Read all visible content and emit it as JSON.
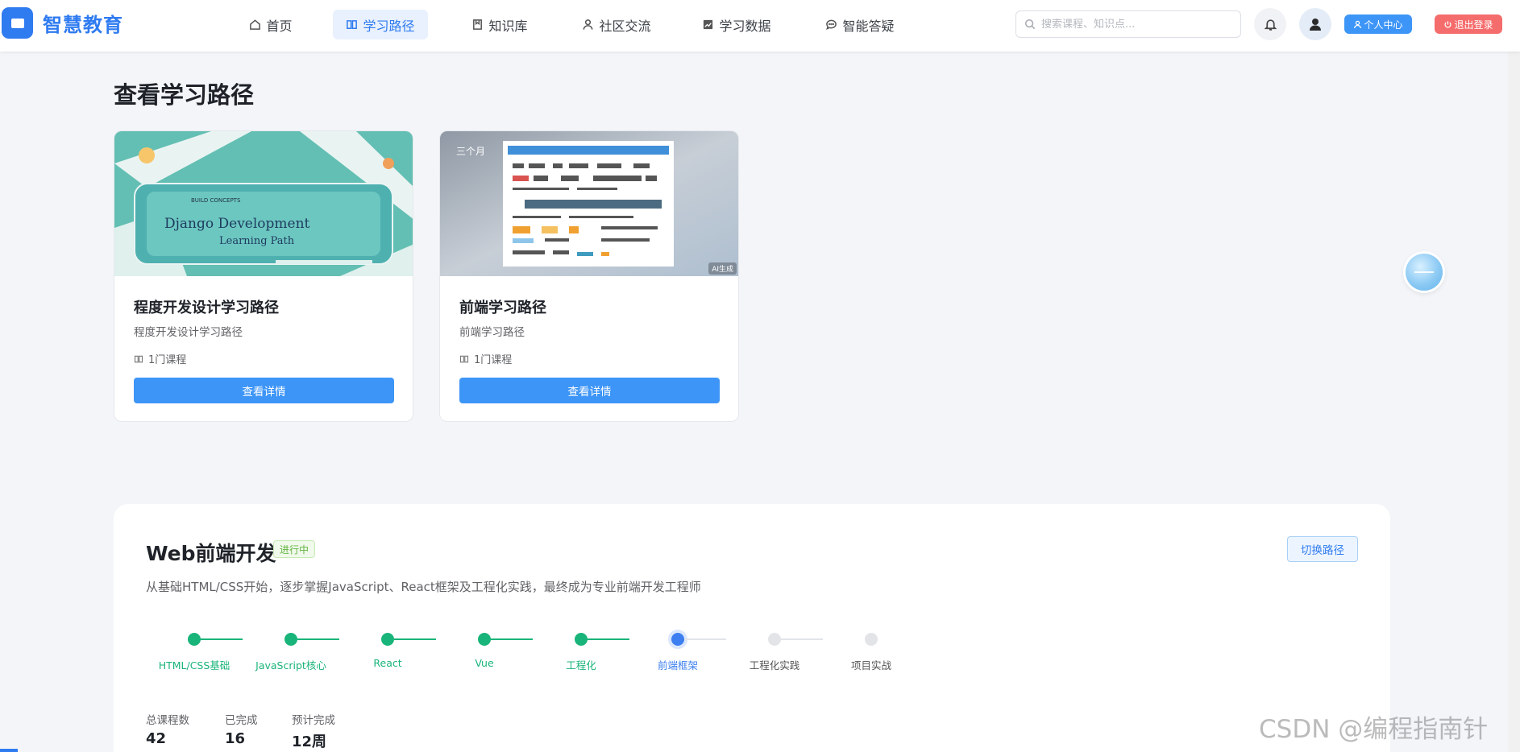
{
  "brand": {
    "name": "智慧教育",
    "accent": "#2f7bf0"
  },
  "nav": {
    "items": [
      {
        "label": "首页",
        "icon": "home-icon",
        "active": false
      },
      {
        "label": "学习路径",
        "icon": "book-open-icon",
        "active": true
      },
      {
        "label": "知识库",
        "icon": "bookmark-book-icon",
        "active": false
      },
      {
        "label": "社区交流",
        "icon": "user-icon",
        "active": false
      },
      {
        "label": "学习数据",
        "icon": "chart-icon",
        "active": false
      },
      {
        "label": "智能答疑",
        "icon": "chat-bubble-icon",
        "active": false
      }
    ]
  },
  "search": {
    "placeholder": "搜索课程、知识点..."
  },
  "user_actions": {
    "profile_label": "个人中心",
    "logout_label": "退出登录"
  },
  "page": {
    "title": "查看学习路径"
  },
  "cards": [
    {
      "title": "程度开发设计学习路径",
      "description": "程度开发设计学习路径",
      "course_count": "1门课程",
      "button_label": "查看详情",
      "image_text": [
        "Django Development",
        "Learning Path"
      ]
    },
    {
      "title": "前端学习路径",
      "description": "前端学习路径",
      "course_count": "1门课程",
      "button_label": "查看详情",
      "duration": "三个月",
      "image_badge": "AI生成"
    }
  ],
  "path": {
    "title": "Web前端开发",
    "status": "进行中",
    "switch_label": "切换路径",
    "description": "从基础HTML/CSS开始，逐步掌握JavaScript、React框架及工程化实践，最终成为专业前端开发工程师",
    "steps": [
      {
        "label": "HTML/CSS基础",
        "state": "done"
      },
      {
        "label": "JavaScript核心",
        "state": "done"
      },
      {
        "label": "React",
        "state": "done"
      },
      {
        "label": "Vue",
        "state": "done"
      },
      {
        "label": "工程化",
        "state": "done"
      },
      {
        "label": "前端框架",
        "state": "current"
      },
      {
        "label": "工程化实践",
        "state": "todo"
      },
      {
        "label": "项目实战",
        "state": "todo"
      }
    ],
    "stats": [
      {
        "label": "总课程数",
        "value": "42"
      },
      {
        "label": "已完成",
        "value": "16"
      },
      {
        "label": "预计完成",
        "value": "12周"
      }
    ]
  },
  "colors": {
    "done": "#19b47a",
    "current": "#3d7ff0",
    "todo": "#e2e4e8",
    "primary_button": "#3d95f7",
    "danger_button": "#f56c6c"
  },
  "watermark": "CSDN @编程指南针"
}
